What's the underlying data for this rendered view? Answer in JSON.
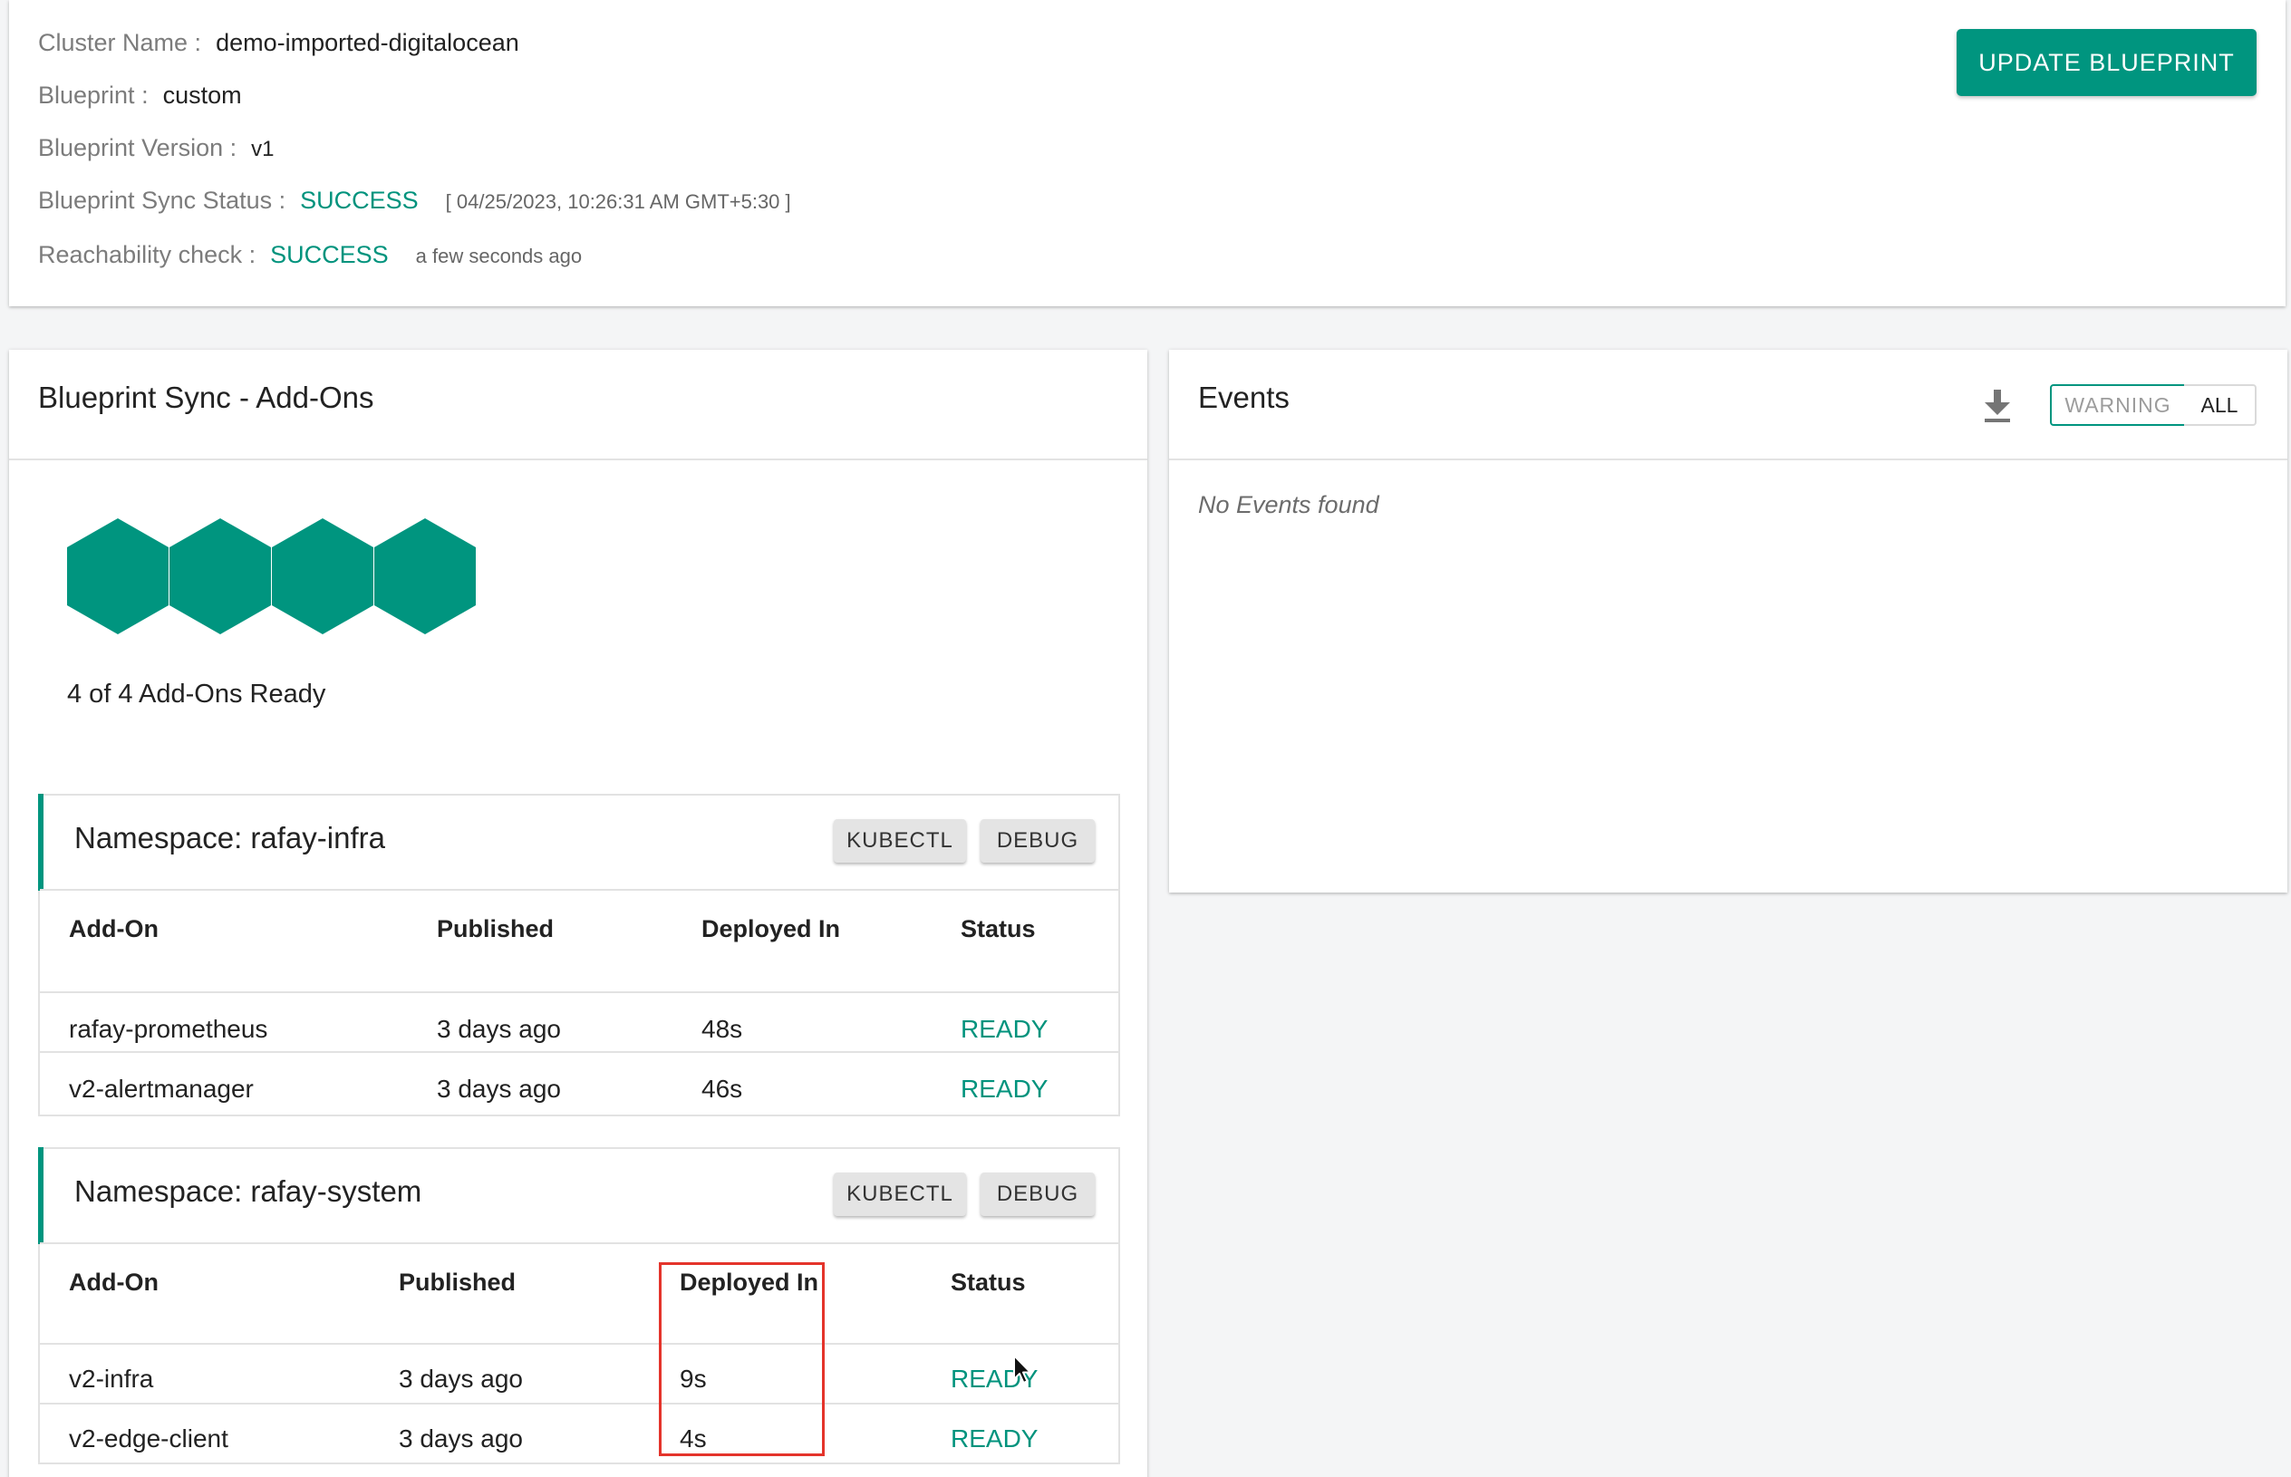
{
  "cluster_info": {
    "cluster_name_label": "Cluster Name :",
    "cluster_name": "demo-imported-digitalocean",
    "blueprint_label": "Blueprint :",
    "blueprint": "custom",
    "blueprint_version_label": "Blueprint Version :",
    "blueprint_version": "v1",
    "sync_status_label": "Blueprint Sync Status :",
    "sync_status": "SUCCESS",
    "sync_timestamp": "[ 04/25/2023, 10:26:31 AM GMT+5:30 ]",
    "reachability_label": "Reachability check :",
    "reachability_status": "SUCCESS",
    "reachability_time": "a few seconds ago",
    "update_button": "UPDATE BLUEPRINT"
  },
  "addons_panel": {
    "title": "Blueprint Sync - Add-Ons",
    "ready_summary": "4 of 4 Add-Ons Ready",
    "hexagon_count": 4,
    "namespaces": [
      {
        "title": "Namespace: rafay-infra",
        "kubectl_label": "KUBECTL",
        "debug_label": "DEBUG",
        "columns": [
          "Add-On",
          "Published",
          "Deployed In",
          "Status"
        ],
        "rows": [
          {
            "addon": "rafay-prometheus",
            "published": "3 days ago",
            "deployed_in": "48s",
            "status": "READY"
          },
          {
            "addon": "v2-alertmanager",
            "published": "3 days ago",
            "deployed_in": "46s",
            "status": "READY"
          }
        ]
      },
      {
        "title": "Namespace: rafay-system",
        "kubectl_label": "KUBECTL",
        "debug_label": "DEBUG",
        "columns": [
          "Add-On",
          "Published",
          "Deployed In",
          "Status"
        ],
        "rows": [
          {
            "addon": "v2-infra",
            "published": "3 days ago",
            "deployed_in": "9s",
            "status": "READY"
          },
          {
            "addon": "v2-edge-client",
            "published": "3 days ago",
            "deployed_in": "4s",
            "status": "READY"
          }
        ]
      }
    ]
  },
  "events_panel": {
    "title": "Events",
    "download_icon": "download-icon",
    "filter_warning": "WARNING",
    "filter_all": "ALL",
    "empty_message": "No Events found"
  },
  "colors": {
    "accent": "#00957f",
    "success_text": "#00937d",
    "highlight_box": "#e4342b"
  }
}
